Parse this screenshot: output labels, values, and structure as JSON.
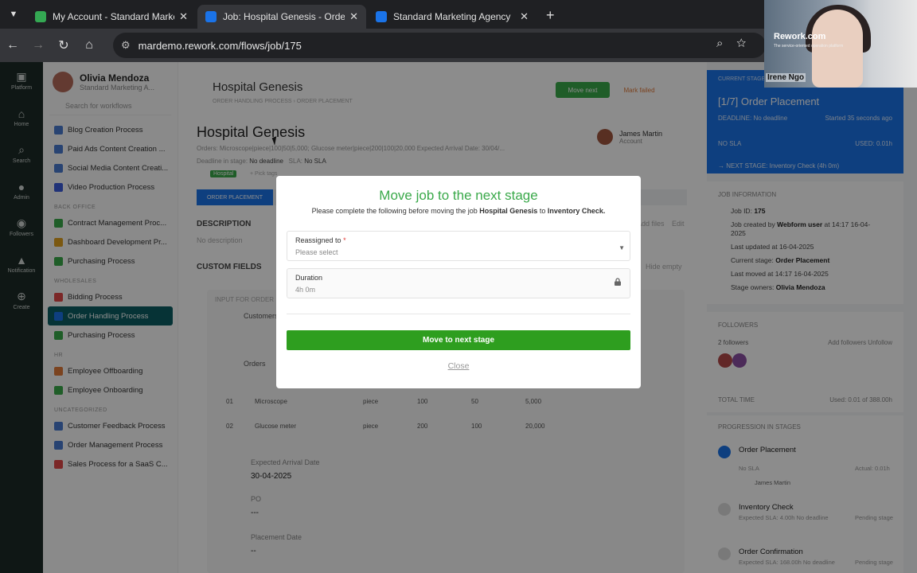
{
  "browser": {
    "tabs": [
      {
        "title": "My Account - Standard Marketi",
        "color": "#34a853"
      },
      {
        "title": "Job: Hospital Genesis - Order H",
        "color": "#1a73e8"
      },
      {
        "title": "Standard Marketing Agency",
        "color": "#1a73e8"
      }
    ],
    "url": "mardemo.rework.com/flows/job/175"
  },
  "rail": [
    {
      "label": "Platform"
    },
    {
      "label": "Home"
    },
    {
      "label": "Search"
    },
    {
      "label": "Admin"
    },
    {
      "label": "Followers"
    },
    {
      "label": "Notification"
    },
    {
      "label": "Create"
    }
  ],
  "sidebar": {
    "user_name": "Olivia Mendoza",
    "user_sub": "Standard Marketing A...",
    "search_placeholder": "Search for workflows",
    "sections": [
      {
        "title": "",
        "items": [
          {
            "label": "Blog Creation Process",
            "color": "#4a7bd0"
          },
          {
            "label": "Paid Ads Content Creation ...",
            "color": "#4a7bd0"
          },
          {
            "label": "Social Media Content Creati...",
            "color": "#4a7bd0"
          },
          {
            "label": "Video Production Process",
            "color": "#3b5bdb"
          }
        ]
      },
      {
        "title": "BACK OFFICE",
        "items": [
          {
            "label": "Contract Management Proc...",
            "color": "#3aa94a"
          },
          {
            "label": "Dashboard Development Pr...",
            "color": "#e0a020"
          },
          {
            "label": "Purchasing Process",
            "color": "#3aa94a"
          }
        ]
      },
      {
        "title": "WHOLESALES",
        "items": [
          {
            "label": "Bidding Process",
            "color": "#e04848"
          },
          {
            "label": "Order Handling Process",
            "color": "#1a73e8"
          },
          {
            "label": "Purchasing Process",
            "color": "#3aa94a"
          }
        ]
      },
      {
        "title": "HR",
        "items": [
          {
            "label": "Employee Offboarding",
            "color": "#e07a3a"
          },
          {
            "label": "Employee Onboarding",
            "color": "#3aa94a"
          }
        ]
      },
      {
        "title": "UNCATEGORIZED",
        "items": [
          {
            "label": "Customer Feedback Process",
            "color": "#4a7bd0"
          },
          {
            "label": "Order Management Process",
            "color": "#4a7bd0"
          },
          {
            "label": "Sales Process for a SaaS C...",
            "color": "#e04848"
          }
        ]
      }
    ]
  },
  "job": {
    "header_title": "Hospital Genesis",
    "breadcrumb": "ORDER HANDLING PROCESS  ›  ORDER PLACEMENT",
    "move_next": "Move next",
    "mark_failed": "Mark failed",
    "title": "Hospital Genesis",
    "orders_meta": "Orders: Microscope|piece|100|50|5,000; Glucose meter|piece|200|100|20,000    Expected Arrival Date: 30/04/...",
    "deadline_label": "Deadline in stage:",
    "deadline_value": "No deadline",
    "sla_label": "SLA:",
    "sla_value": "No SLA",
    "tag": "Hospital",
    "pick_tags": "+ Pick tags",
    "assignee_name": "James Martin",
    "assignee_role": "Account",
    "stage_tab": "ORDER PLACEMENT",
    "description_label": "DESCRIPTION",
    "description_value": "No description",
    "files_label": "Add files",
    "edit_label": "Edit",
    "custom_fields_label": "CUSTOM FIELDS",
    "hide_empty": "Hide empty",
    "input_label": "INPUT FOR ORDER",
    "customers_label": "Customers",
    "orders_label": "Orders",
    "order_rows": [
      {
        "no": "01",
        "name": "Microscope",
        "unit": "piece",
        "qty": "100",
        "price": "50",
        "total": "5,000"
      },
      {
        "no": "02",
        "name": "Glucose meter",
        "unit": "piece",
        "qty": "200",
        "price": "100",
        "total": "20,000"
      }
    ],
    "arrival_label": "Expected Arrival Date",
    "arrival_value": "30-04-2025",
    "po_label": "PO",
    "po_value": "---",
    "placement_label": "Placement Date",
    "placement_value": "--"
  },
  "right": {
    "current_stage_label": "CURRENT STAGE",
    "current_stage": "[1/7] Order Placement",
    "deadline": "DEADLINE: No deadline",
    "started": "Started 35 seconds ago",
    "sla": "NO SLA",
    "used": "USED: 0.01h",
    "next_stage": "→ NEXT STAGE: Inventory Check (4h 0m)",
    "job_info_label": "JOB INFORMATION",
    "job_id_label": "Job ID:",
    "job_id": "175",
    "created_label": "Job created by",
    "created_by": "Webform user",
    "created_time": "at 14:17 16-04-",
    "created_year": "2025",
    "updated": "Last updated at 16-04-2025",
    "current_stage_row_label": "Current stage:",
    "current_stage_row": "Order Placement",
    "last_moved": "Last moved at 14:17 16-04-2025",
    "owners_label": "Stage owners:",
    "owners": "Olivia Mendoza",
    "followers_label": "FOLLOWERS",
    "followers_count": "2 followers",
    "followers_actions": "Add followers   Unfollow",
    "total_time_label": "TOTAL TIME",
    "total_time_value": "Used: 0.01 of 388.00h",
    "progression_label": "PROGRESSION IN STAGES",
    "stages": [
      {
        "name": "Order Placement",
        "sub": "No SLA",
        "right": "Actual: 0.01h",
        "person": "James Martin"
      },
      {
        "name": "Inventory Check",
        "sub": "Expected SLA: 4.00h  No deadline",
        "right": "Pending stage",
        "person": ""
      },
      {
        "name": "Order Confirmation",
        "sub": "Expected SLA: 168.00h  No deadline",
        "right": "Pending stage",
        "person": ""
      }
    ]
  },
  "modal": {
    "title": "Move job to the next stage",
    "sub_before": "Please complete the following before moving the job",
    "job": "Hospital Genesis",
    "sub_to": "to",
    "stage": "Inventory Check.",
    "field1_label": "Reassigned to",
    "field1_req": "*",
    "field1_value": "Please select",
    "field2_label": "Duration",
    "field2_value": "4h 0m",
    "submit": "Move to next stage",
    "close": "Close"
  },
  "camera": {
    "logo": "Rework.com",
    "tagline": "The service-oriented operation platform",
    "person": "Irene Ngo"
  }
}
